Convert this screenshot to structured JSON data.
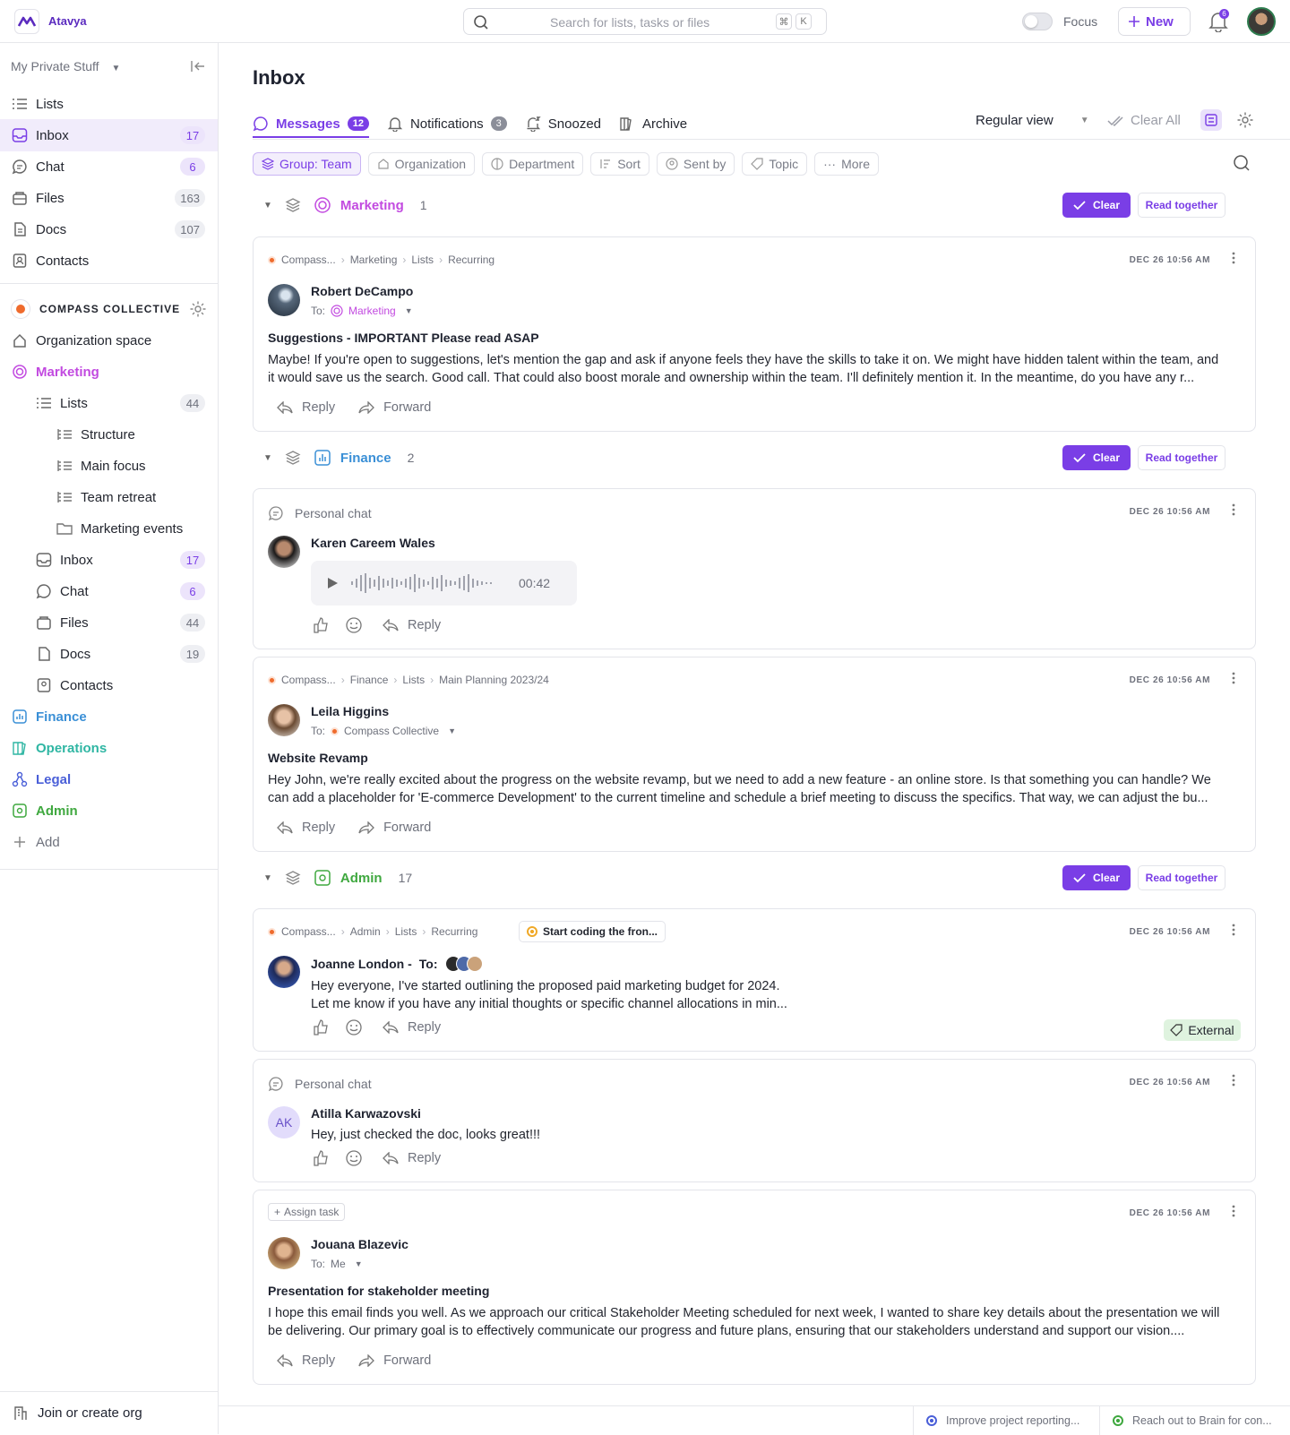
{
  "app": {
    "brand": "Atavya",
    "search_placeholder": "Search for lists, tasks or files",
    "kbd1": "⌘",
    "kbd2": "K",
    "focus_label": "Focus",
    "new_label": "New",
    "notif_count": "6"
  },
  "sidebar": {
    "header": "My Private Stuff",
    "items": [
      {
        "label": "Lists",
        "count": ""
      },
      {
        "label": "Inbox",
        "count": "17"
      },
      {
        "label": "Chat",
        "count": "6"
      },
      {
        "label": "Files",
        "count": "163"
      },
      {
        "label": "Docs",
        "count": "107"
      },
      {
        "label": "Contacts",
        "count": ""
      }
    ],
    "org_name": "COMPASS COLLECTIVE",
    "org_space": "Organization space",
    "marketing": "Marketing",
    "mk_items": [
      {
        "label": "Lists",
        "count": "44"
      },
      {
        "label": "Structure"
      },
      {
        "label": "Main focus"
      },
      {
        "label": "Team retreat"
      },
      {
        "label": "Marketing events"
      },
      {
        "label": "Inbox",
        "count": "17"
      },
      {
        "label": "Chat",
        "count": "6"
      },
      {
        "label": "Files",
        "count": "44"
      },
      {
        "label": "Docs",
        "count": "19"
      },
      {
        "label": "Contacts"
      }
    ],
    "teams": [
      {
        "label": "Finance",
        "color": "#3a8fd6"
      },
      {
        "label": "Operations",
        "color": "#2fb6a3"
      },
      {
        "label": "Legal",
        "color": "#4a5fd8"
      },
      {
        "label": "Admin",
        "color": "#3fa83f"
      }
    ],
    "add": "Add",
    "join": "Join or create org"
  },
  "inbox": {
    "title": "Inbox",
    "tabs": [
      {
        "label": "Messages",
        "badge": "12"
      },
      {
        "label": "Notifications",
        "badge": "3"
      },
      {
        "label": "Snoozed"
      },
      {
        "label": "Archive"
      }
    ],
    "view": "Regular view",
    "clear_all": "Clear All",
    "filters": [
      "Group: Team",
      "Organization",
      "Department",
      "Sort",
      "Sent by",
      "Topic",
      "More"
    ]
  },
  "groups": [
    {
      "name": "Marketing",
      "count": "1",
      "color": "#c24ae0"
    },
    {
      "name": "Finance",
      "count": "2",
      "color": "#3a8fd6"
    },
    {
      "name": "Admin",
      "count": "17",
      "color": "#3fa83f"
    }
  ],
  "buttons": {
    "clear": "Clear",
    "read_together": "Read together",
    "reply": "Reply",
    "forward": "Forward",
    "to": "To:",
    "external": "External",
    "assign_task": "Assign task"
  },
  "messages": {
    "m1": {
      "crumbs": [
        "Compass...",
        "Marketing",
        "Lists",
        "Recurring"
      ],
      "date": "DEC 26 10:56 AM",
      "sender": "Robert DeCampo",
      "to": "Marketing",
      "subject": "Suggestions - IMPORTANT Please read ASAP",
      "body": "Maybe! If you're open to suggestions, let's mention the gap and ask if anyone feels they have the skills to take it on. We might have hidden talent within the team, and it would save us the search. Good call. That could also boost morale and ownership within the team. I'll definitely mention it. In the meantime, do you have any r..."
    },
    "m2": {
      "source": "Personal chat",
      "date": "DEC 26 10:56 AM",
      "sender": "Karen Careem Wales",
      "duration": "00:42"
    },
    "m3": {
      "crumbs": [
        "Compass...",
        "Finance",
        "Lists",
        "Main Planning 2023/24"
      ],
      "date": "DEC 26 10:56 AM",
      "sender": "Leila Higgins",
      "to": "Compass Collective",
      "subject": "Website Revamp",
      "body": "Hey John, we're really excited about the progress on the website revamp, but we need to add a new feature - an online store. Is that something you can handle? We can add a placeholder for 'E-commerce Development' to the current timeline and schedule a brief meeting to discuss the specifics. That way, we can adjust the bu..."
    },
    "m4": {
      "crumbs": [
        "Compass...",
        "Admin",
        "Lists",
        "Recurring"
      ],
      "task": "Start coding the fron...",
      "date": "DEC 26 10:56 AM",
      "sender": "Joanne London -",
      "body1": "Hey everyone, I've started outlining the proposed paid marketing budget for 2024.",
      "body2": "Let me know if you have any initial thoughts or specific channel allocations in min..."
    },
    "m5": {
      "source": "Personal chat",
      "date": "DEC 26 10:56 AM",
      "initials": "AK",
      "sender": "Atilla Karwazovski",
      "body": "Hey, just checked the doc, looks great!!!"
    },
    "m6": {
      "date": "DEC 26 10:56 AM",
      "sender": "Jouana Blazevic",
      "to": "Me",
      "subject": "Presentation for stakeholder meeting",
      "body": "I hope this email finds you well. As we approach our critical Stakeholder Meeting scheduled for next week, I wanted to share key details about the presentation we will be delivering. Our primary goal is to effectively communicate our progress and future plans, ensuring that our stakeholders understand and support our vision...."
    }
  },
  "bottom": [
    "Improve project reporting...",
    "Reach out to Brain for con..."
  ]
}
